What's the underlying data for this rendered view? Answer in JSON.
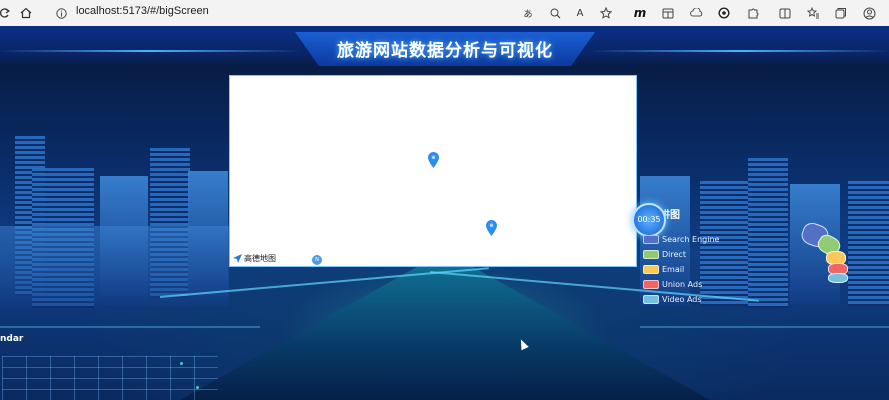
{
  "browser": {
    "url": "localhost:5173/#/bigScreen",
    "icons": [
      "reload-icon",
      "home-icon",
      "info-icon",
      "translate-icon",
      "zoom-icon",
      "read-aloud-icon",
      "favorite-icon",
      "m-extension-icon",
      "extension-icon",
      "cloud-icon",
      "copilot-icon",
      "puzzle-icon",
      "split-screen-icon",
      "favorites-icon",
      "collections-icon",
      "profile-icon"
    ]
  },
  "dashboard": {
    "title": "旅游网站数据分析与可视化",
    "map": {
      "provider_label": "高德地图"
    },
    "pie": {
      "title_partial": "讲图",
      "timer": "00:35",
      "legend": [
        {
          "label": "Search Engine",
          "color": "#5470c6"
        },
        {
          "label": "Direct",
          "color": "#91cc75"
        },
        {
          "label": "Email",
          "color": "#fac858"
        },
        {
          "label": "Union Ads",
          "color": "#ee6666"
        },
        {
          "label": "Video Ads",
          "color": "#73c0de"
        }
      ]
    },
    "calendar": {
      "title_partial": "ndar"
    }
  }
}
